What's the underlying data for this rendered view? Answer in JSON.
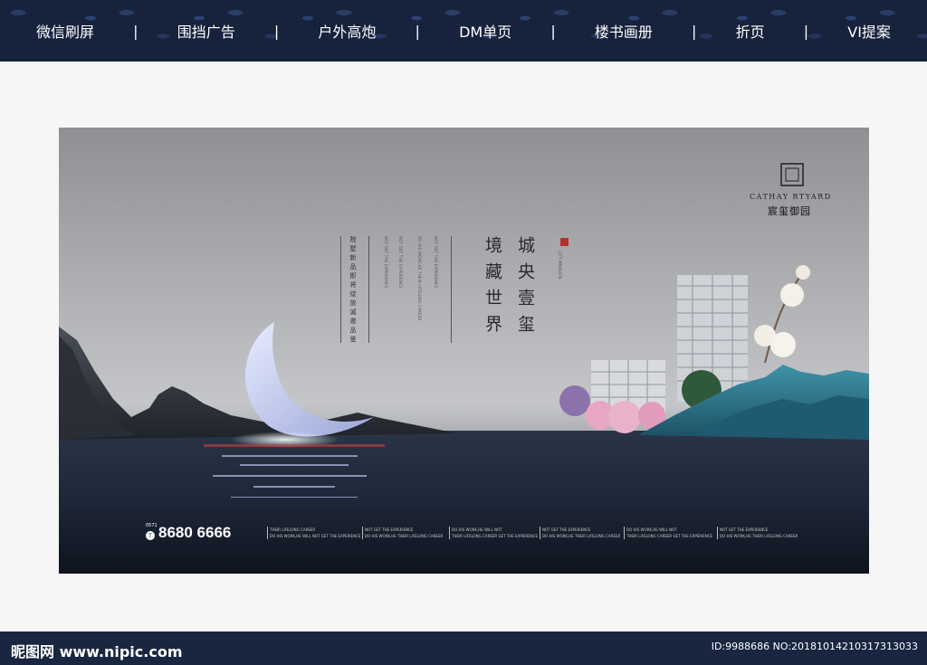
{
  "nav": {
    "items": [
      "微信刷屏",
      "围挡广告",
      "户外高炮",
      "DM单页",
      "楼书画册",
      "折页",
      "VI提案"
    ],
    "separator": "|"
  },
  "poster": {
    "brand_en": "CATHAY RTYARD",
    "brand_cn": "宸玺御园",
    "headline_col1": "城央壹玺",
    "headline_col2": "境藏世界",
    "seal_text": "CITY MANSION",
    "small_col1": "院墅新品即将绽放",
    "small_col2": "诚邀品鉴",
    "english_cols": [
      "NOT GET THE EXPERIENCE",
      "NOT GET THE EXPERIENCE",
      "DO HIS WORK,HE THEIR LIFELONG CAREER",
      "NOT GET THE EXPERIENCE"
    ],
    "phone_area": "0571",
    "phone": "8680 6666",
    "slogans": [
      {
        "l1": "THEIR LIFELONG CAREER",
        "l2": "DO HIS WORK,HE WILL NOT GET THE EXPERIENCE"
      },
      {
        "l1": "NOT GET THE EXPERIENCE",
        "l2": "DO HIS WORK,HE THEIR LIFELONG CAREER"
      },
      {
        "l1": "DO HIS WORK,HE WILL NOT",
        "l2": "THEIR LIFELONG CAREER GET THE EXPERIENCE"
      },
      {
        "l1": "NOT GET THE EXPERIENCE",
        "l2": "DO HIS WORK,HE THEIR LIFELONG CAREER"
      },
      {
        "l1": "DO HIS WORK,HE WILL NOT",
        "l2": "THEIR LIFELONG CAREER GET THE EXPERIENCE"
      },
      {
        "l1": "NOT GET THE EXPERIENCE",
        "l2": "DO HIS WORK,HE THEIR LIFELONG CAREER"
      }
    ]
  },
  "watermark": {
    "left": "昵图网 www.nipic.com",
    "right": "ID:9988686 NO:20181014210317313033"
  },
  "colors": {
    "nav_bg": "#17223c",
    "water": "#1c2638",
    "mountain_teal": "#2a6f86",
    "mountain_dark": "#30353d",
    "blossom": "#e7a7c4"
  }
}
